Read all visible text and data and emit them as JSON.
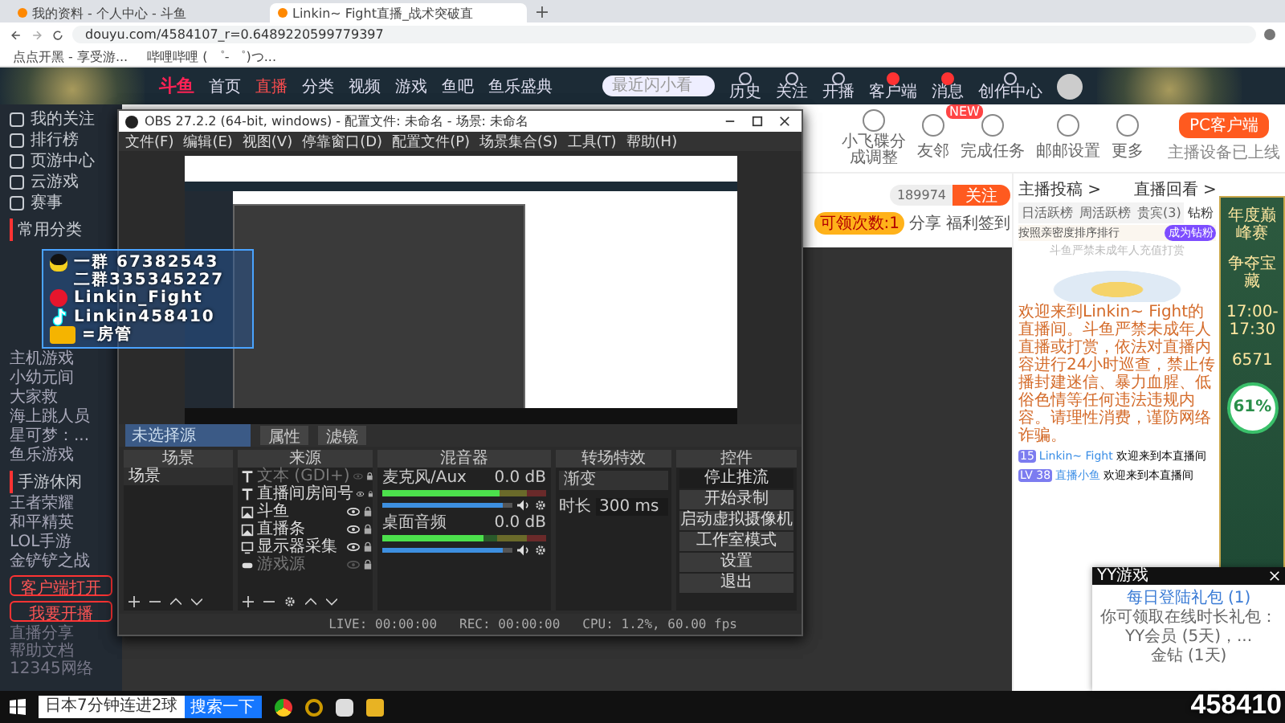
{
  "browser": {
    "tabs": [
      {
        "label": "我的资料 - 个人中心 - 斗鱼",
        "selected": false
      },
      {
        "label": "Linkin~ Fight直播_战术突破直",
        "selected": true
      }
    ],
    "url": "douyu.com/4584107_r=0.6489220599779397",
    "bookmarks": [
      "点点开黑 - 享受游...",
      "哔哩哔哩 ( ゜- ゜)つ..."
    ]
  },
  "site_header": {
    "logo": "斗鱼",
    "nav": [
      {
        "label": "首页",
        "selected": false
      },
      {
        "label": "直播",
        "selected": true
      },
      {
        "label": "分类",
        "selected": false
      },
      {
        "label": "视频",
        "selected": false
      },
      {
        "label": "游戏",
        "selected": false
      },
      {
        "label": "鱼吧",
        "selected": false
      },
      {
        "label": "鱼乐盛典",
        "selected": false
      }
    ],
    "search_placeholder": "最近闪小看",
    "tools": [
      {
        "label": "历史",
        "badge": false
      },
      {
        "label": "关注",
        "badge": false
      },
      {
        "label": "开播",
        "badge": false
      },
      {
        "label": "客户端",
        "badge": true
      },
      {
        "label": "消息",
        "badge": true
      },
      {
        "label": "创作中心",
        "badge": false
      }
    ]
  },
  "sidebar": {
    "items": [
      "我的关注",
      "排行榜",
      "页游中心",
      "云游戏",
      "赛事"
    ],
    "section_title": "常用分类",
    "games": [
      "主机游戏",
      "小幼元间",
      "大家救",
      "海上跳人员",
      "星可梦：...",
      "鱼乐游戏"
    ],
    "mobile_title": "手游休闲",
    "mobile_games": [
      "王者荣耀",
      "和平精英",
      "LOL手游",
      "金铲铲之战"
    ],
    "buttons": [
      "客户端打开",
      "我要开播"
    ],
    "footer": [
      "直播分享",
      "帮助文档",
      "12345网络"
    ]
  },
  "toolbar": {
    "items": [
      {
        "label": "小飞碟分成调整"
      },
      {
        "label": "友邻",
        "tag": "NEW"
      },
      {
        "label": "完成任务"
      },
      {
        "label": "邮邮设置"
      },
      {
        "label": "更多"
      }
    ],
    "client_button": "PC客户端",
    "client_note": "主播设备已上线"
  },
  "room": {
    "fans": "189974",
    "follow": "关注",
    "claims": "可领次数:1",
    "share": "分享",
    "checkin": "福利签到"
  },
  "right_panel": {
    "links": [
      "主播投稿 >",
      "直播回看 >"
    ],
    "tabs": [
      {
        "label": "日活跃榜",
        "selected": false
      },
      {
        "label": "周活跃榜",
        "selected": false
      },
      {
        "label": "贵宾(3)",
        "selected": false
      },
      {
        "label": "钻粉",
        "selected": true
      }
    ],
    "sort_label": "按照亲密度排序排行",
    "join_button": "成为钻粉",
    "empty_note": "斗鱼严禁未成年人充值打赏",
    "welcome": "欢迎来到Linkin~ Fight的直播间。斗鱼严禁未成年人直播或打赏，依法对直播内容进行24小时巡查，禁止传播封建迷信、暴力血腥、低俗色情等任何违法违规内容。请理性消费，谨防网络诈骗。",
    "chat": [
      {
        "badge": "15",
        "name": "Linkin~ Fight",
        "message": "欢迎来到本直播间"
      },
      {
        "badge": "LV 38",
        "name": "直播小鱼",
        "message": "欢迎来到本直播间"
      }
    ],
    "banner": [
      "年度巅峰赛",
      "争夺宝藏",
      "17:00-17:30",
      "6571",
      "61%"
    ]
  },
  "obs": {
    "title": "OBS 27.2.2 (64-bit, windows) - 配置文件: 未命名 - 场景: 未命名",
    "menu": [
      "文件(F)",
      "编辑(E)",
      "视图(V)",
      "停靠窗口(D)",
      "配置文件(P)",
      "场景集合(S)",
      "工具(T)",
      "帮助(H)"
    ],
    "source_bar": {
      "label": "未选择源",
      "buttons": [
        "属性",
        "滤镜"
      ]
    },
    "docks": [
      "场景",
      "来源",
      "混音器",
      "转场特效",
      "控件"
    ],
    "scenes": [
      {
        "label": "场景",
        "selected": true
      }
    ],
    "sources": [
      {
        "kind": "text",
        "label": "文本 (GDI+)",
        "visible": false
      },
      {
        "kind": "text",
        "label": "直播间房间号",
        "visible": true
      },
      {
        "kind": "image",
        "label": "斗鱼",
        "visible": true
      },
      {
        "kind": "image",
        "label": "直播条",
        "visible": true
      },
      {
        "kind": "monitor",
        "label": "显示器采集",
        "visible": true
      },
      {
        "kind": "game",
        "label": "游戏源",
        "visible": false
      }
    ],
    "mixer": [
      {
        "name": "麦克风/Aux",
        "db": "0.0 dB",
        "level": 0.72,
        "volume": {
          "level": 0.92
        }
      },
      {
        "name": "桌面音频",
        "db": "0.0 dB",
        "level": 0.62,
        "volume": {
          "level": 0.92
        }
      }
    ],
    "transition": {
      "type": "渐变",
      "duration_label": "时长",
      "duration": "300 ms"
    },
    "controls": [
      "停止推流",
      "开始录制",
      "启动虚拟摄像机",
      "工作室模式",
      "设置",
      "退出"
    ],
    "status": [
      "LIVE: 00:00:00",
      "REC: 00:00:00",
      "CPU: 1.2%, 60.00 fps"
    ]
  },
  "overlay": [
    {
      "kind": "qq",
      "text": "一群 67382543"
    },
    {
      "kind": "none",
      "text": "二群335345227"
    },
    {
      "kind": "weibo",
      "text": "Linkin_Fight"
    },
    {
      "kind": "tiktok",
      "text": "Linkin458410"
    },
    {
      "kind": "badge",
      "text": "=房管"
    }
  ],
  "yy_popup": {
    "title": "YY游戏",
    "heading": "每日登陆礼包 (1)",
    "lines": [
      "你可领取在线时长礼包：",
      "YY会员 (5天)，...",
      "金钻 (1天)"
    ]
  },
  "taskbar": {
    "search": "日本7分钟连进2球",
    "search_button": "搜索一下"
  },
  "stream_number": "458410"
}
